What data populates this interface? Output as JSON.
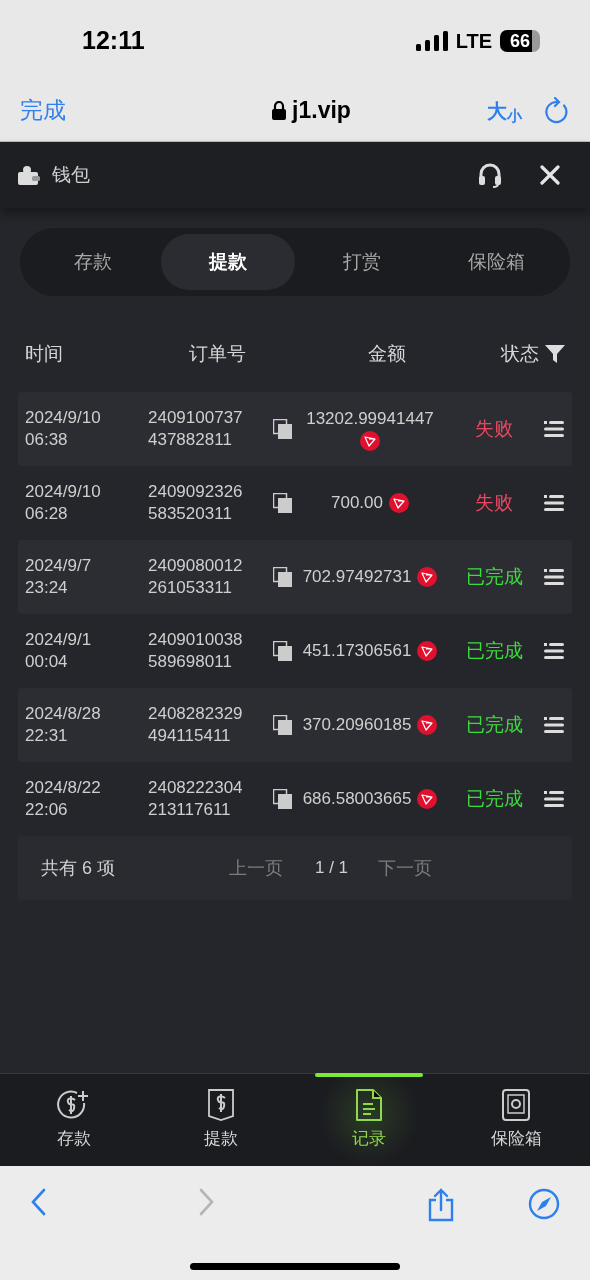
{
  "status_bar": {
    "time": "12:11",
    "network": "LTE",
    "battery": "66"
  },
  "browser_bar": {
    "done": "完成",
    "url": "j1.vip",
    "text_size": "大$_{小}$"
  },
  "header": {
    "title": "钱包"
  },
  "tabs": [
    {
      "label": "存款",
      "selected": false
    },
    {
      "label": "提款",
      "selected": true
    },
    {
      "label": "打赏",
      "selected": false
    },
    {
      "label": "保险箱",
      "selected": false
    }
  ],
  "table": {
    "columns": [
      "时间",
      "订单号",
      "金额",
      "状态"
    ],
    "rows": [
      {
        "date": "2024/9/10",
        "time": "06:38",
        "order": [
          "2409100737",
          "437882811"
        ],
        "amount": "13202.99941447",
        "status": "失败",
        "kind": "failed"
      },
      {
        "date": "2024/9/10",
        "time": "06:28",
        "order": [
          "2409092326",
          "583520311"
        ],
        "amount": "700.00",
        "status": "失败",
        "kind": "failed"
      },
      {
        "date": "2024/9/7",
        "time": "23:24",
        "order": [
          "2409080012",
          "261053311"
        ],
        "amount": "702.97492731",
        "status": "已完成",
        "kind": "completed"
      },
      {
        "date": "2024/9/1",
        "time": "00:04",
        "order": [
          "2409010038",
          "589698011"
        ],
        "amount": "451.17306561",
        "status": "已完成",
        "kind": "completed"
      },
      {
        "date": "2024/8/28",
        "time": "22:31",
        "order": [
          "2408282329",
          "494115411"
        ],
        "amount": "370.20960185",
        "status": "已完成",
        "kind": "completed"
      },
      {
        "date": "2024/8/22",
        "time": "22:06",
        "order": [
          "2408222304",
          "213117611"
        ],
        "amount": "686.58003665",
        "status": "已完成",
        "kind": "completed"
      }
    ]
  },
  "pagination": {
    "total": "共有 6 项",
    "prev": "上一页",
    "page": "1 / 1",
    "next": "下一页"
  },
  "bottom_nav": [
    {
      "label": "存款",
      "kind": "deposit",
      "selected": false
    },
    {
      "label": "提款",
      "kind": "withdraw",
      "selected": false
    },
    {
      "label": "记录",
      "kind": "record",
      "selected": true
    },
    {
      "label": "保险箱",
      "kind": "safe",
      "selected": false
    }
  ]
}
